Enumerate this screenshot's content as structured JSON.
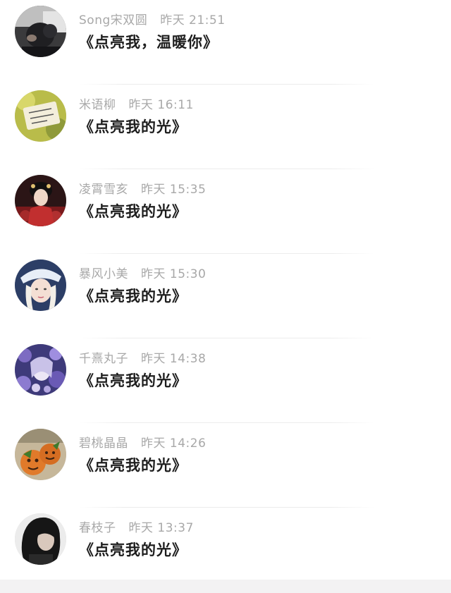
{
  "comments": [
    {
      "user": "Song宋双圆",
      "time": "昨天 21:51",
      "text": "《点亮我，温暖你》",
      "avatar_icon": "dark-photo-avatar"
    },
    {
      "user": "米语柳",
      "time": "昨天 16:11",
      "text": "《点亮我的光》",
      "avatar_icon": "yellow-note-avatar"
    },
    {
      "user": "凌霄雪亥",
      "time": "昨天 15:35",
      "text": "《点亮我的光》",
      "avatar_icon": "red-costume-avatar"
    },
    {
      "user": "暴风小美",
      "time": "昨天 15:30",
      "text": "《点亮我的光》",
      "avatar_icon": "blue-hat-girl-avatar"
    },
    {
      "user": "千熹丸子",
      "time": "昨天 14:38",
      "text": "《点亮我的光》",
      "avatar_icon": "purple-flower-avatar"
    },
    {
      "user": "碧桃晶晶",
      "time": "昨天 14:26",
      "text": "《点亮我的光》",
      "avatar_icon": "pumpkin-faces-avatar"
    },
    {
      "user": "春枝子",
      "time": "昨天 13:37",
      "text": "《点亮我的光》",
      "avatar_icon": "black-hair-avatar"
    }
  ],
  "colors": {
    "username": "#a8a8a8",
    "comment_text": "#1d1d1d",
    "background": "#ffffff"
  }
}
